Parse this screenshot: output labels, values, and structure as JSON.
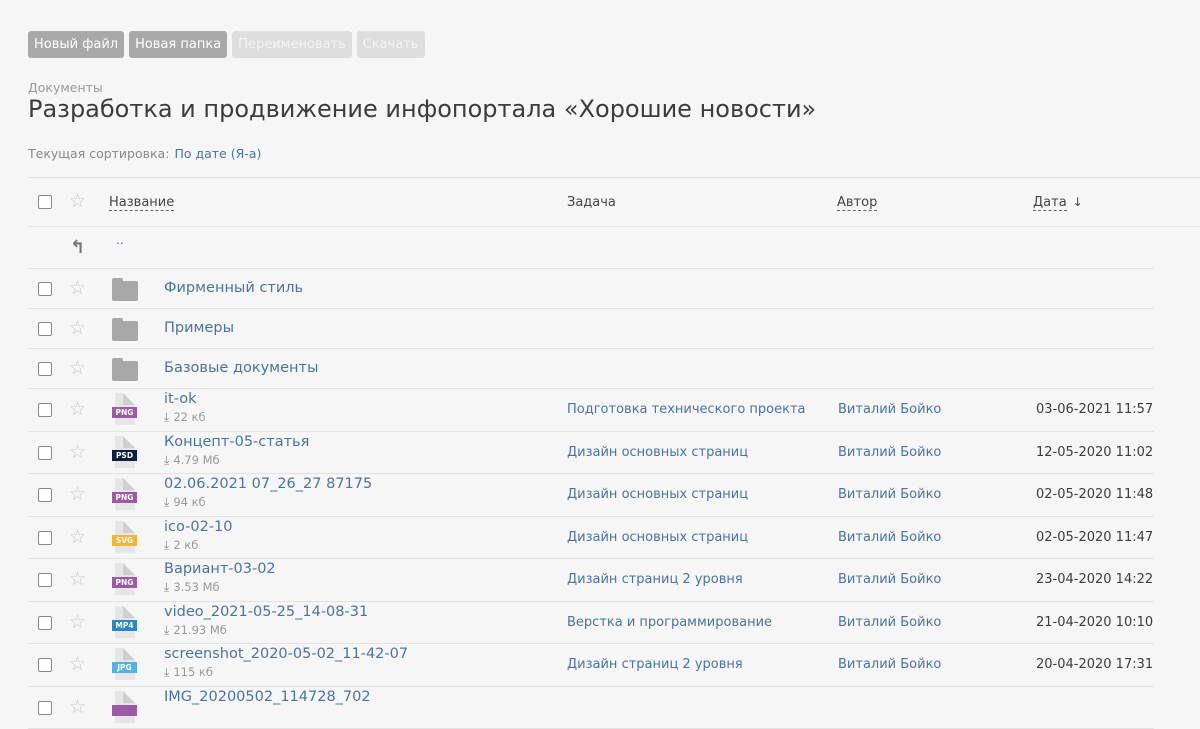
{
  "toolbar": {
    "new_file": "Новый файл",
    "new_folder": "Новая папка",
    "rename": "Переименовать",
    "download": "Скачать"
  },
  "breadcrumb": "Документы",
  "title": "Разработка и продвижение инфопортала «Хорошие новости»",
  "sort": {
    "label": "Текущая сортировка:",
    "value": "По дате (Я-а)"
  },
  "columns": {
    "name": "Название",
    "task": "Задача",
    "author": "Автор",
    "date": "Дата"
  },
  "up_label": "..",
  "folders": [
    {
      "name": "Фирменный стиль"
    },
    {
      "name": "Примеры"
    },
    {
      "name": "Базовые документы"
    }
  ],
  "files": [
    {
      "name": "it-ok",
      "size": "22 кб",
      "ext": "PNG",
      "ext_color": "#9b59a6",
      "task": "Подготовка технического проекта",
      "author": "Виталий Бойко",
      "date": "03-06-2021 11:57"
    },
    {
      "name": "Концепт-05-статья",
      "size": "4.79 Мб",
      "ext": "PSD",
      "ext_color": "#0c1f3d",
      "task": "Дизайн основных страниц",
      "author": "Виталий Бойко",
      "date": "12-05-2020 11:02"
    },
    {
      "name": "02.06.2021 07_26_27 87175",
      "size": "94 кб",
      "ext": "PNG",
      "ext_color": "#9b59a6",
      "task": "Дизайн основных страниц",
      "author": "Виталий Бойко",
      "date": "02-05-2020 11:48"
    },
    {
      "name": "ico-02-10",
      "size": "2 кб",
      "ext": "SVG",
      "ext_color": "#f5b338",
      "task": "Дизайн основных страниц",
      "author": "Виталий Бойко",
      "date": "02-05-2020 11:47"
    },
    {
      "name": "Вариант-03-02",
      "size": "3.53 Мб",
      "ext": "PNG",
      "ext_color": "#9b59a6",
      "task": "Дизайн страниц 2 уровня",
      "author": "Виталий Бойко",
      "date": "23-04-2020 14:22"
    },
    {
      "name": "video_2021-05-25_14-08-31",
      "size": "21.93 Мб",
      "ext": "MP4",
      "ext_color": "#2b86c5",
      "task": "Верстка и программирование",
      "author": "Виталий Бойко",
      "date": "21-04-2020 10:10"
    },
    {
      "name": "screenshot_2020-05-02_11-42-07",
      "size": "115 кб",
      "ext": "JPG",
      "ext_color": "#4fb3e8",
      "task": "Дизайн страниц 2 уровня",
      "author": "Виталий Бойко",
      "date": "20-04-2020 17:31"
    },
    {
      "name": "IMG_20200502_114728_702",
      "size": "",
      "ext": "",
      "ext_color": "#9b59a6",
      "task": "",
      "author": "",
      "date": ""
    }
  ]
}
